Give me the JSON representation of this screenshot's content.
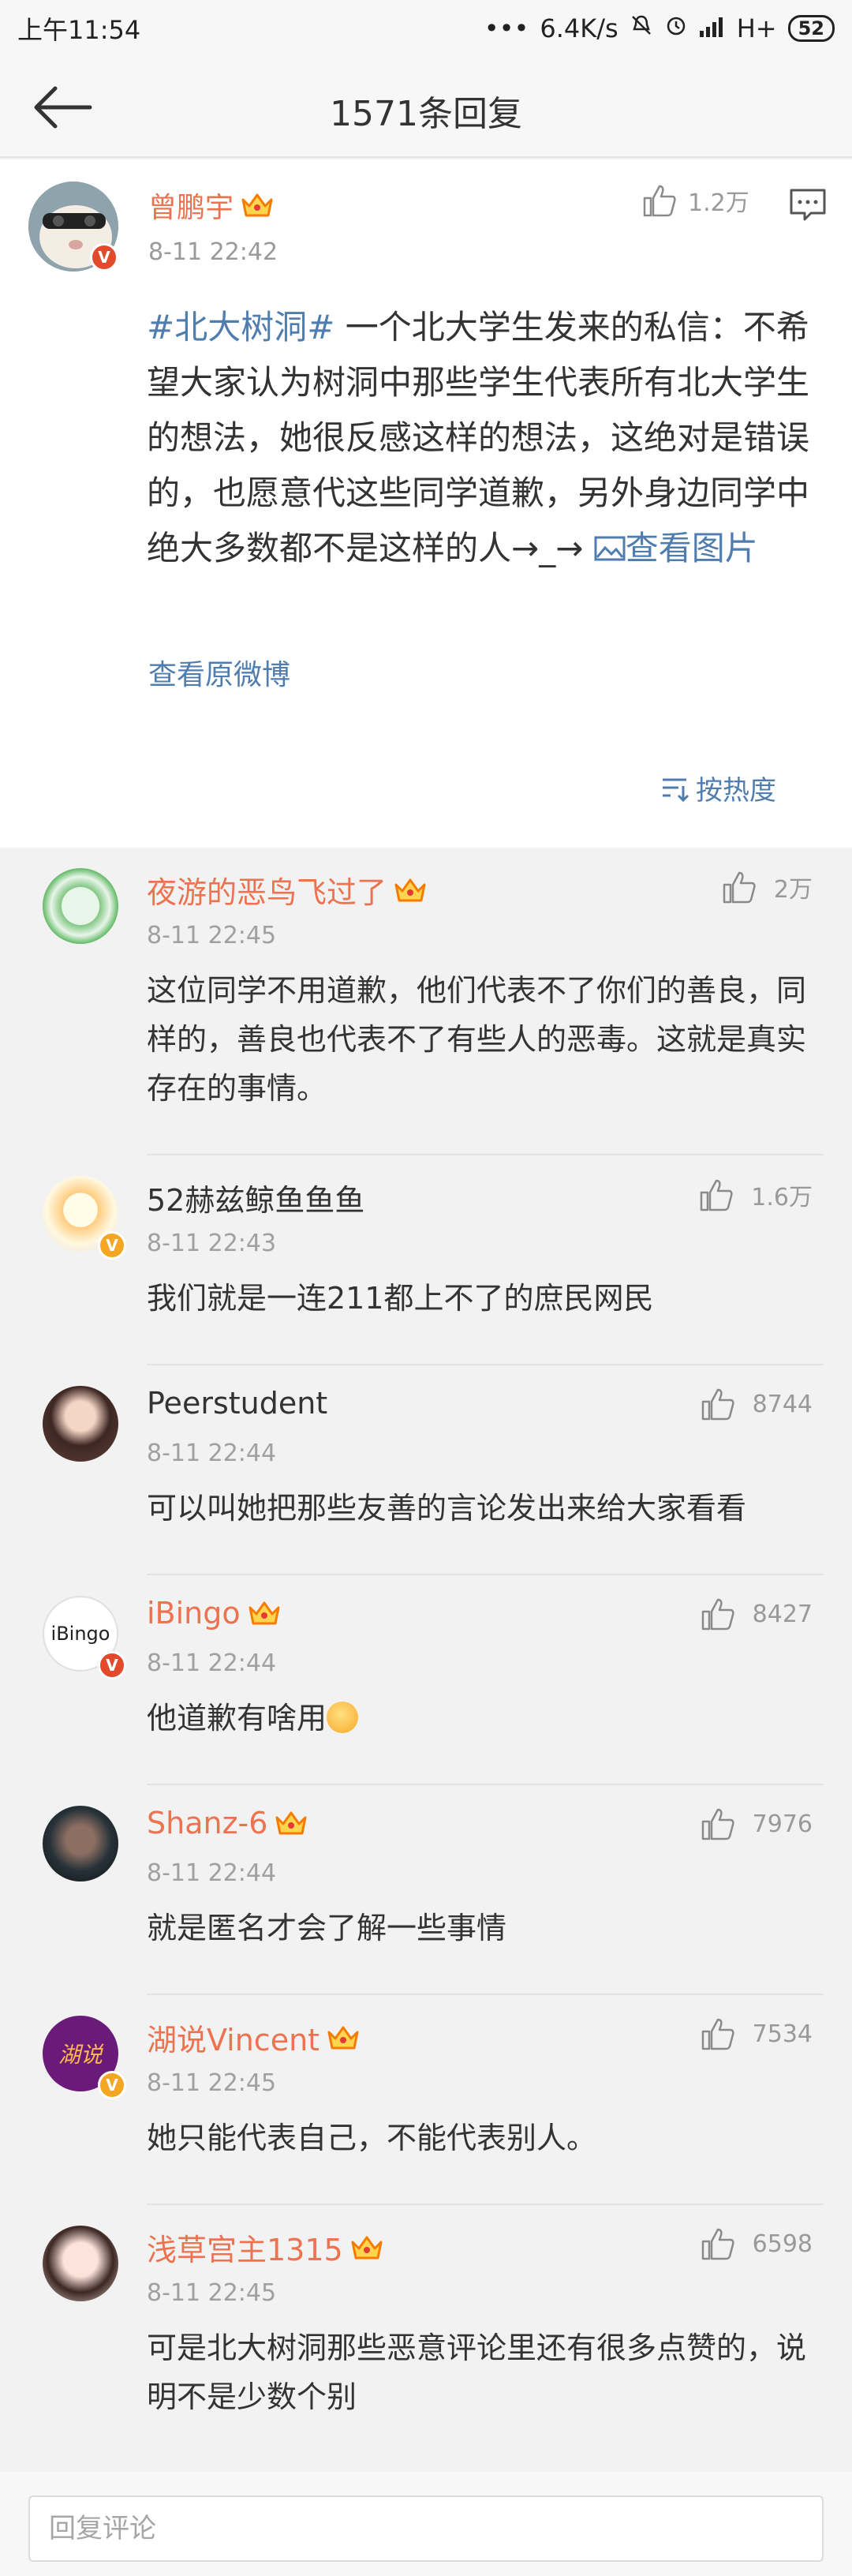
{
  "status_bar": {
    "time": "上午11:54",
    "dots": "•••",
    "speed": "6.4K/s",
    "network": "H+",
    "battery": "52"
  },
  "header": {
    "title": "1571条回复"
  },
  "post": {
    "author": "曾鹏宇",
    "time": "8-11 22:42",
    "likes": "1.2万",
    "hashtag": "#北大树洞#",
    "text": " 一个北大学生发来的私信：不希望大家认为树洞中那些学生代表所有北大学生的想法，她很反感这样的想法，这绝对是错误的，也愿意代这些同学道歉，另外身边同学中绝大多数都不是这样的人→_→ ",
    "view_image": "查看图片",
    "view_original": "查看原微博",
    "sort_label": "按热度"
  },
  "comments": [
    {
      "name": "夜游的恶鸟飞过了",
      "vip": true,
      "verified": false,
      "time": "8-11 22:45",
      "likes": "2万",
      "text": "这位同学不用道歉，他们代表不了你们的善良，同样的，善良也代表不了有些人的恶毒。这就是真实存在的事情。"
    },
    {
      "name": "52赫兹鲸鱼鱼鱼",
      "vip": false,
      "verified": true,
      "time": "8-11 22:43",
      "likes": "1.6万",
      "text": "我们就是一连211都上不了的庶民网民"
    },
    {
      "name": "Peerstudent",
      "vip": false,
      "verified": false,
      "time": "8-11 22:44",
      "likes": "8744",
      "text": "可以叫她把那些友善的言论发出来给大家看看"
    },
    {
      "name": "iBingo",
      "vip": true,
      "verified": true,
      "avatar_text": "iBingo",
      "time": "8-11 22:44",
      "likes": "8427",
      "text": "他道歉有啥用"
    },
    {
      "name": "Shanz-6",
      "vip": true,
      "verified": false,
      "time": "8-11 22:44",
      "likes": "7976",
      "text": "就是匿名才会了解一些事情"
    },
    {
      "name": "湖说Vincent",
      "vip": true,
      "verified": true,
      "avatar_text": "湖说",
      "time": "8-11 22:45",
      "likes": "7534",
      "text": "她只能代表自己，不能代表别人。"
    },
    {
      "name": "浅草宫主1315",
      "vip": true,
      "verified": false,
      "time": "8-11 22:45",
      "likes": "6598",
      "text": "可是北大树洞那些恶意评论里还有很多点赞的，说明不是少数个别"
    }
  ],
  "reply_input": {
    "placeholder": "回复评论"
  },
  "colors": {
    "vip_name": "#eb7350",
    "link": "#507daf",
    "background": "#f2f2f2"
  }
}
